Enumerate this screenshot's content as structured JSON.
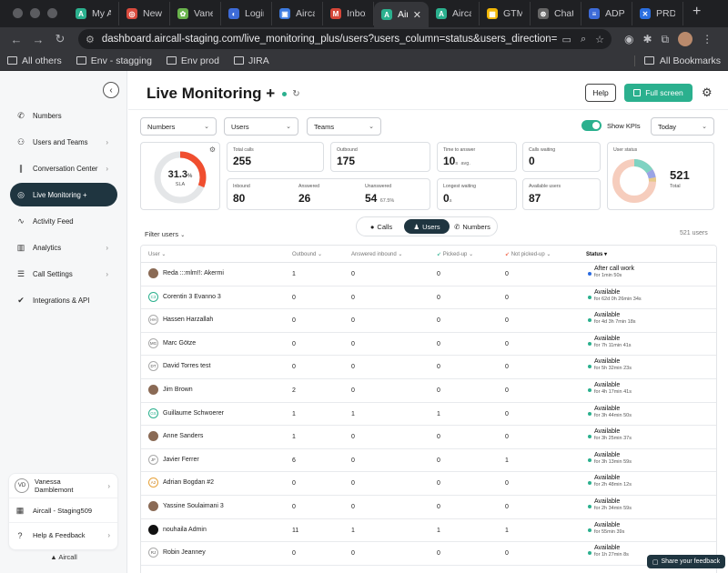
{
  "browser": {
    "tabs": [
      {
        "label": "My Ap",
        "color": "#2bb08e",
        "glyph": "A"
      },
      {
        "label": "New Li",
        "color": "#d94a3d",
        "glyph": "◎"
      },
      {
        "label": "Vanes",
        "color": "#69b34c",
        "glyph": "✿"
      },
      {
        "label": "Login |",
        "color": "#3d6bd8",
        "glyph": "◐"
      },
      {
        "label": "Aircall",
        "color": "#3d7be0",
        "glyph": "▣"
      },
      {
        "label": "Inbox",
        "color": "#d64638",
        "glyph": "M"
      },
      {
        "label": "Air",
        "color": "#2bb08e",
        "glyph": "A",
        "active": true
      },
      {
        "label": "Aircall",
        "color": "#2bb08e",
        "glyph": "A"
      },
      {
        "label": "GTM R",
        "color": "#f2b705",
        "glyph": "▦"
      },
      {
        "label": "ChatG",
        "color": "#666666",
        "glyph": "⊛"
      },
      {
        "label": "ADP R",
        "color": "#3d6bd8",
        "glyph": "≡"
      },
      {
        "label": "PRD -",
        "color": "#2b6fe0",
        "glyph": "✕"
      }
    ],
    "url": "dashboard.aircall-staging.com/live_monitoring_plus/users?users_column=status&users_direction=desc&number...",
    "bookmarks": [
      "All others",
      "Env - stagging",
      "Env prod",
      "JIRA"
    ],
    "all_bookmarks": "All Bookmarks"
  },
  "sidebar": {
    "items": [
      {
        "label": "Numbers",
        "icon": "phone-icon",
        "chevron": false
      },
      {
        "label": "Users and Teams",
        "icon": "users-icon",
        "chevron": true
      },
      {
        "label": "Conversation Center",
        "icon": "waveform-icon",
        "chevron": true
      },
      {
        "label": "Live Monitoring +",
        "icon": "live-icon",
        "chevron": false,
        "active": true
      },
      {
        "label": "Activity Feed",
        "icon": "activity-icon",
        "chevron": false
      },
      {
        "label": "Analytics",
        "icon": "chart-icon",
        "chevron": true
      },
      {
        "label": "Call Settings",
        "icon": "sliders-icon",
        "chevron": true
      },
      {
        "label": "Integrations & API",
        "icon": "integrations-icon",
        "chevron": false
      }
    ],
    "account": {
      "initials": "VD",
      "name": "Vanessa Damblemont"
    },
    "company": "Aircall - Staging509",
    "help": "Help & Feedback",
    "brand": "Aircall"
  },
  "header": {
    "title": "Live Monitoring +",
    "help": "Help",
    "fullscreen": "Full screen"
  },
  "filters": {
    "numbers": "Numbers",
    "users": "Users",
    "teams": "Teams",
    "show_kpis": "Show KPIs",
    "period": "Today"
  },
  "kpis": {
    "sla_value": "31.3",
    "sla_unit": "%",
    "sla_label": "SLA",
    "sla_fraction": 0.313,
    "total_calls_label": "Total calls",
    "total_calls": "255",
    "outbound_label": "Outbound",
    "outbound": "175",
    "time_to_answer_label": "Time to answer",
    "time_to_answer": "10",
    "time_to_answer_unit": "s",
    "time_to_answer_note": "avg.",
    "calls_waiting_label": "Calls waiting",
    "calls_waiting": "0",
    "inbound_label": "Inbound",
    "inbound": "80",
    "answered_label": "Answered",
    "answered": "26",
    "unanswered_label": "Unanswered",
    "unanswered": "54",
    "unanswered_pct": "67.5%",
    "longest_waiting_label": "Longest waiting",
    "longest_waiting": "0",
    "longest_waiting_unit": "s",
    "available_users_label": "Available users",
    "available_users": "87",
    "user_status_label": "User status",
    "user_status_total": "521",
    "user_status_total_label": "Total"
  },
  "view_switch": {
    "calls": "Calls",
    "users": "Users",
    "numbers": "Numbers"
  },
  "table": {
    "filter_users": "Filter users",
    "count": "521 users",
    "columns": {
      "user": "User",
      "outbound": "Outbound",
      "answered_inbound": "Answered inbound",
      "picked_up": "Picked-up",
      "not_picked_up": "Not picked-up",
      "status": "Status"
    },
    "rows": [
      {
        "name": "Reda :::mlm!!: Akermi",
        "avatar": "photo",
        "initials": "",
        "outbound": "1",
        "answered": "0",
        "picked": "0",
        "not_picked": "0",
        "status": "After call work",
        "for": "for 1min 50s",
        "dot": "blue"
      },
      {
        "name": "Corentin 3 Evanno 3",
        "avatar": "green",
        "initials": "C3",
        "outbound": "0",
        "answered": "0",
        "picked": "0",
        "not_picked": "0",
        "status": "Available",
        "for": "for 62d 0h 26min 34s",
        "dot": "green"
      },
      {
        "name": "Hassen Harzallah",
        "avatar": "plain",
        "initials": "HH",
        "outbound": "0",
        "answered": "0",
        "picked": "0",
        "not_picked": "0",
        "status": "Available",
        "for": "for 4d 3h 7min 18s",
        "dot": "green"
      },
      {
        "name": "Marc Götze",
        "avatar": "plain",
        "initials": "MG",
        "outbound": "0",
        "answered": "0",
        "picked": "0",
        "not_picked": "0",
        "status": "Available",
        "for": "for 7h 11min 41s",
        "dot": "green"
      },
      {
        "name": "David Torres test",
        "avatar": "plain",
        "initials": "DT",
        "outbound": "0",
        "answered": "0",
        "picked": "0",
        "not_picked": "0",
        "status": "Available",
        "for": "for 5h 32min 23s",
        "dot": "green"
      },
      {
        "name": "Jim Brown",
        "avatar": "photo",
        "initials": "",
        "outbound": "2",
        "answered": "0",
        "picked": "0",
        "not_picked": "0",
        "status": "Available",
        "for": "for 4h 17min 41s",
        "dot": "green"
      },
      {
        "name": "Guillaume Schwoerer",
        "avatar": "green",
        "initials": "GS",
        "outbound": "1",
        "answered": "1",
        "picked": "1",
        "not_picked": "0",
        "status": "Available",
        "for": "for 3h 44min 50s",
        "dot": "green"
      },
      {
        "name": "Anne Sanders",
        "avatar": "photo",
        "initials": "",
        "outbound": "1",
        "answered": "0",
        "picked": "0",
        "not_picked": "0",
        "status": "Available",
        "for": "for 3h 25min 37s",
        "dot": "green"
      },
      {
        "name": "Javier Ferrer",
        "avatar": "plain",
        "initials": "JF",
        "outbound": "6",
        "answered": "0",
        "picked": "0",
        "not_picked": "1",
        "status": "Available",
        "for": "for 3h 13min 59s",
        "dot": "green"
      },
      {
        "name": "Adrian Bogdan #2",
        "avatar": "orange",
        "initials": "A2",
        "outbound": "0",
        "answered": "0",
        "picked": "0",
        "not_picked": "0",
        "status": "Available",
        "for": "for 2h 48min 12s",
        "dot": "green"
      },
      {
        "name": "Yassine Soulaimani 3",
        "avatar": "photo",
        "initials": "",
        "outbound": "0",
        "answered": "0",
        "picked": "0",
        "not_picked": "0",
        "status": "Available",
        "for": "for 2h 34min 59s",
        "dot": "green"
      },
      {
        "name": "nouhaila Admin",
        "avatar": "cat",
        "initials": "",
        "outbound": "11",
        "answered": "1",
        "picked": "1",
        "not_picked": "1",
        "status": "Available",
        "for": "for 55min 39s",
        "dot": "green"
      },
      {
        "name": "Robin Jeanney",
        "avatar": "plain",
        "initials": "RJ",
        "outbound": "0",
        "answered": "0",
        "picked": "0",
        "not_picked": "0",
        "status": "Available",
        "for": "for 1h 27min 8s",
        "dot": "green"
      }
    ]
  },
  "share_feedback": "Share your feedback",
  "colors": {
    "accent": "#2bb08e",
    "sla_arc": "#f04e2f",
    "nav_active": "#1f3540"
  }
}
